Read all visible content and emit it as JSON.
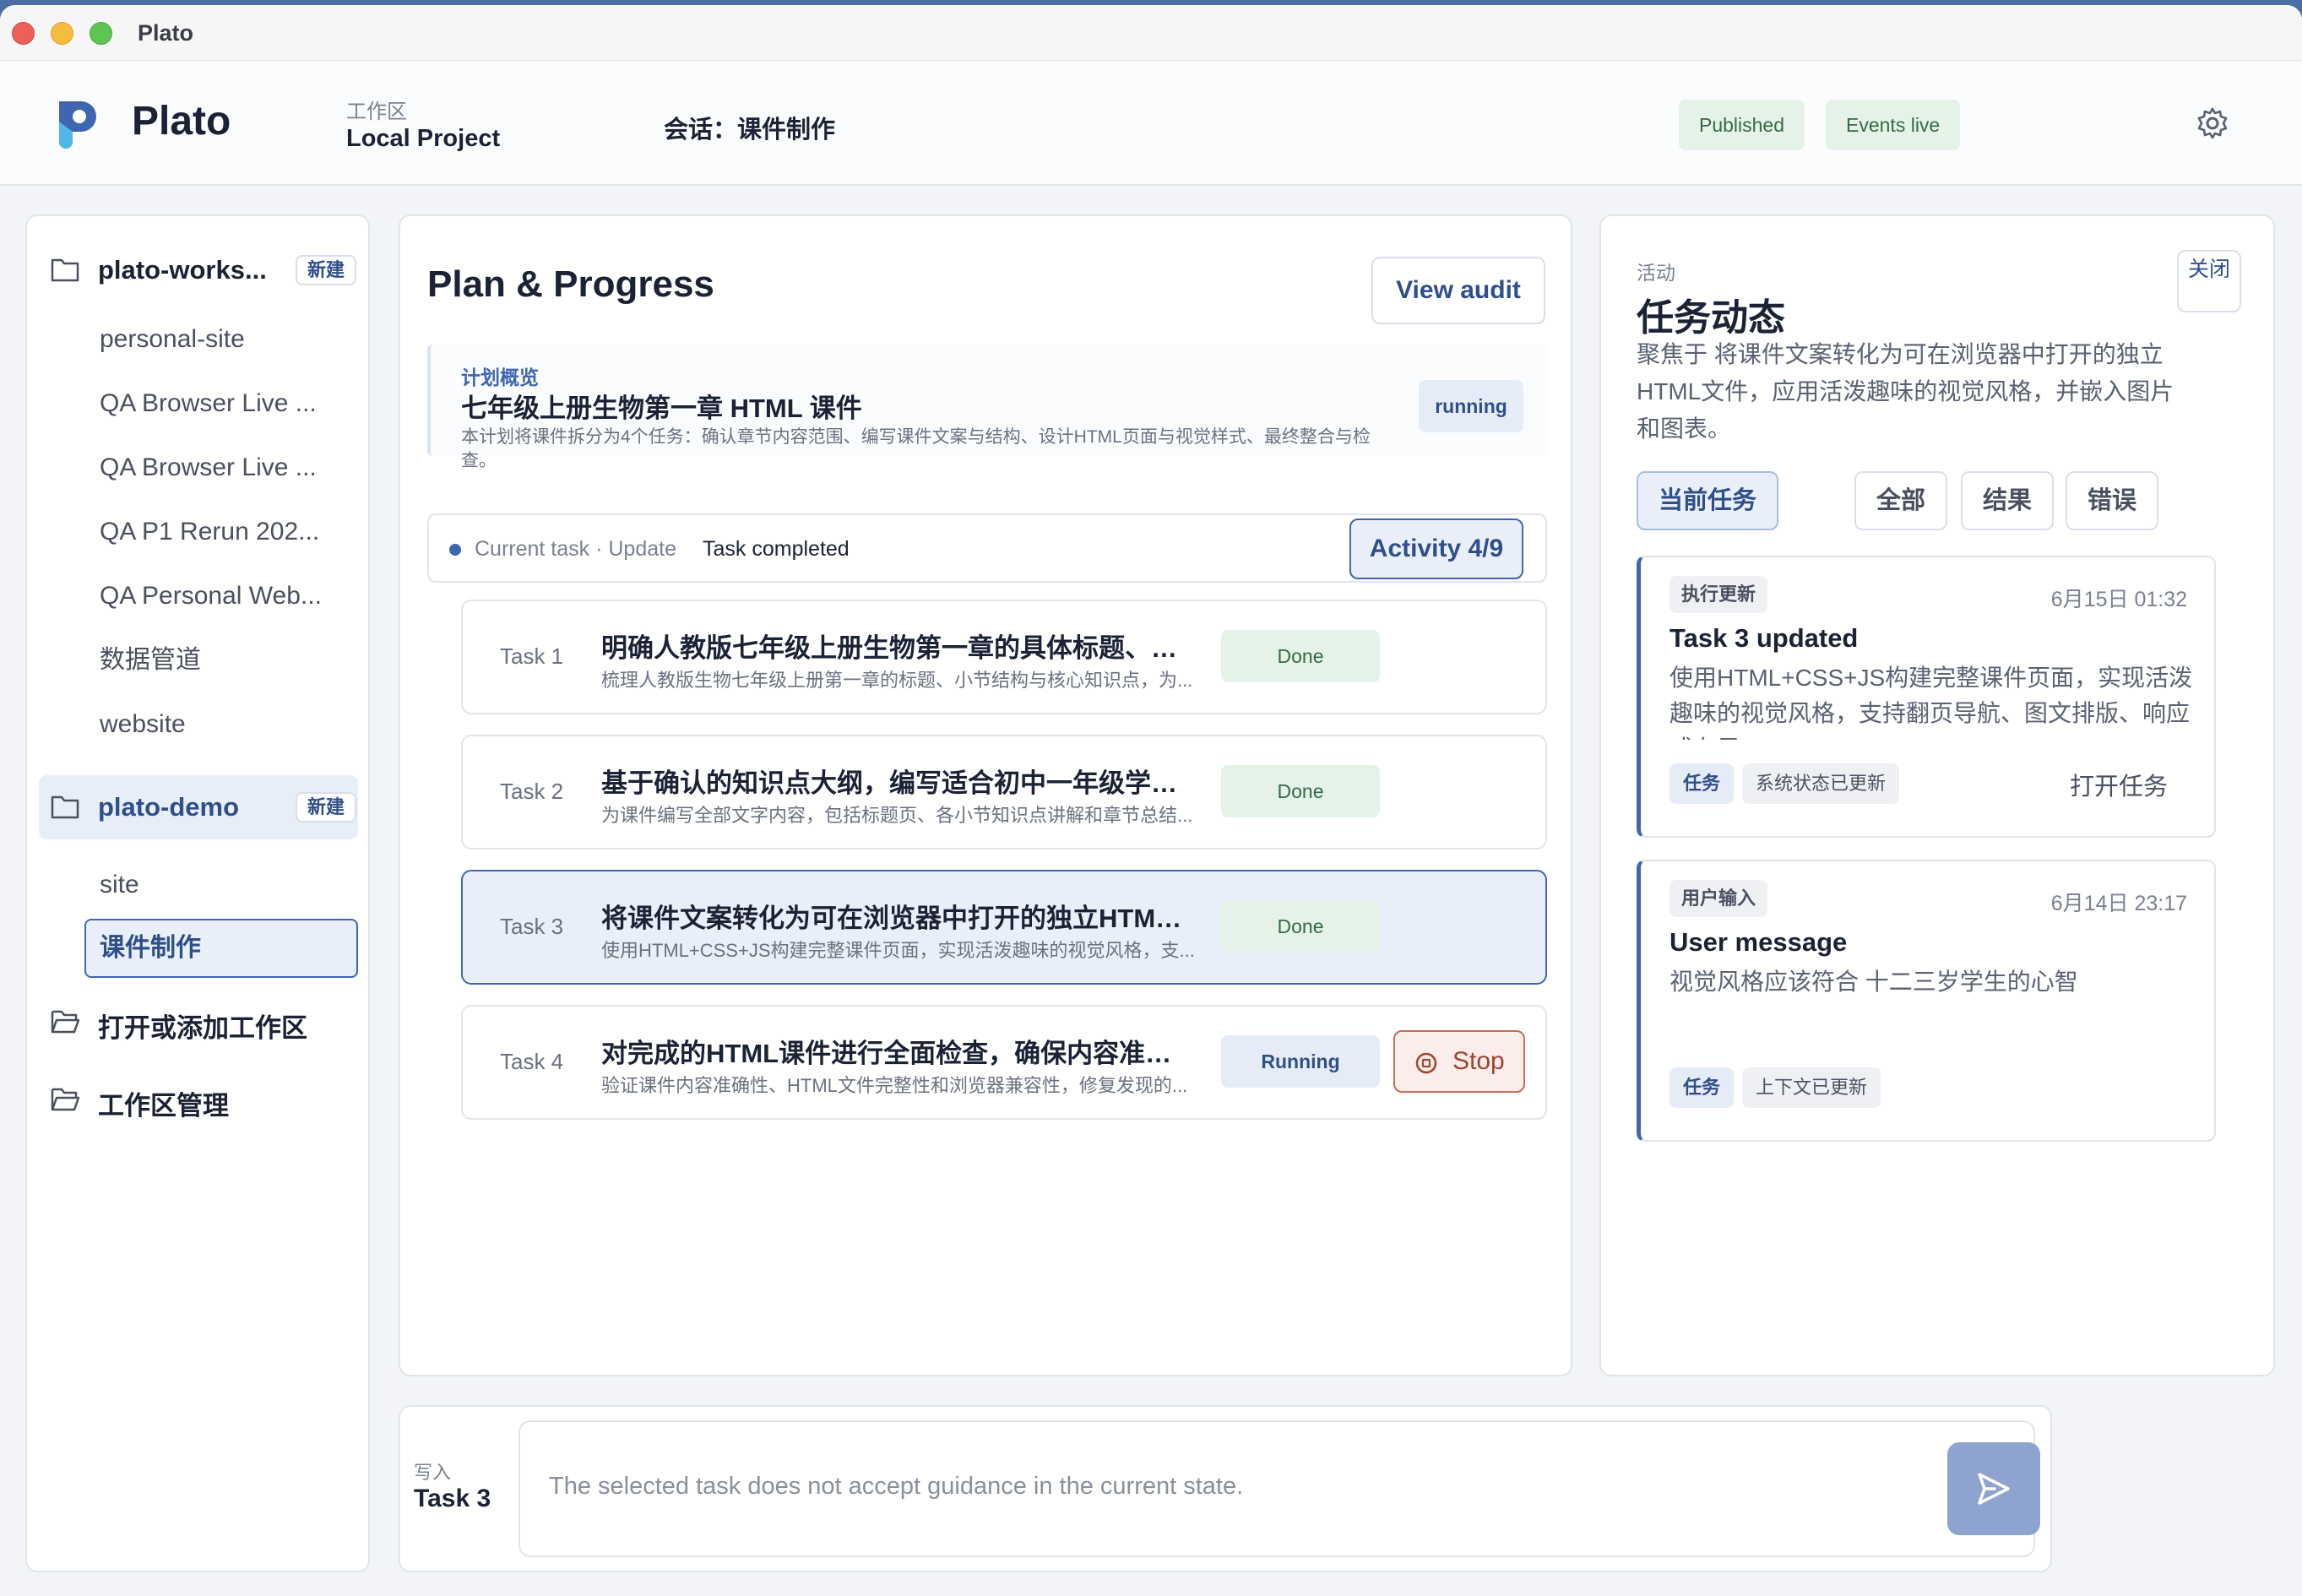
{
  "window": {
    "title": "Plato"
  },
  "header": {
    "brand": "Plato",
    "workspace_label": "工作区",
    "workspace_value": "Local Project",
    "session": "会话：课件制作",
    "badges": [
      "Published",
      "Events live"
    ],
    "settings_icon": "gear-icon"
  },
  "sidebar": {
    "workspaces": [
      {
        "name": "plato-works...",
        "new_label": "新建",
        "sessions": [
          "personal-site",
          "QA Browser Live ...",
          "QA Browser Live ...",
          "QA P1 Rerun 202...",
          "QA Personal Web...",
          "数据管道",
          "website"
        ]
      },
      {
        "name": "plato-demo",
        "new_label": "新建",
        "sessions": [
          "site",
          "课件制作"
        ],
        "active_session": "课件制作"
      }
    ],
    "actions": [
      "打开或添加工作区",
      "工作区管理"
    ]
  },
  "main": {
    "title": "Plan & Progress",
    "audit_button": "View audit",
    "overview": {
      "label": "计划概览",
      "title": "七年级上册生物第一章 HTML 课件",
      "desc": "本计划将课件拆分为4个任务：确认章节内容范围、编写课件文案与结构、设计HTML页面与视觉样式、最终整合与检查。",
      "status": "running"
    },
    "current": {
      "text": "Current task · Update",
      "strong": "Task completed",
      "activity_button": "Activity 4/9"
    },
    "tasks": [
      {
        "num": "Task 1",
        "title": "明确人教版七年级上册生物第一章的具体标题、小...",
        "desc": "梳理人教版生物七年级上册第一章的标题、小节结构与核心知识点，为...",
        "status": "Done"
      },
      {
        "num": "Task 2",
        "title": "基于确认的知识点大纲，编写适合初中一年级学生...",
        "desc": "为课件编写全部文字内容，包括标题页、各小节知识点讲解和章节总结...",
        "status": "Done"
      },
      {
        "num": "Task 3",
        "title": "将课件文案转化为可在浏览器中打开的独立HTML...",
        "desc": "使用HTML+CSS+JS构建完整课件页面，实现活泼趣味的视觉风格，支...",
        "status": "Done"
      },
      {
        "num": "Task 4",
        "title": "对完成的HTML课件进行全面检查，确保内容准确...",
        "desc": "验证课件内容准确性、HTML文件完整性和浏览器兼容性，修复发现的...",
        "status": "Running",
        "stop_label": "Stop"
      }
    ]
  },
  "activity": {
    "label": "活动",
    "title": "任务动态",
    "close_label": "关闭",
    "desc": "聚焦于 将课件文案转化为可在浏览器中打开的独立HTML文件，应用活泼趣味的视觉风格，并嵌入图片和图表。",
    "filters": [
      "当前任务",
      "全部",
      "结果",
      "错误"
    ],
    "events": [
      {
        "tag": "执行更新",
        "date": "6月15日 01:32",
        "title": "Task 3 updated",
        "body": "使用HTML+CSS+JS构建完整课件页面，实现活泼趣味的视觉风格，支持翻页导航、图文排版、响应式布局。",
        "chips": [
          "任务",
          "系统状态已更新"
        ],
        "open_label": "打开任务"
      },
      {
        "tag": "用户输入",
        "date": "6月14日 23:17",
        "title": "User message",
        "body": "视觉风格应该符合 十二三岁学生的心智",
        "chips": [
          "任务",
          "上下文已更新"
        ]
      }
    ]
  },
  "composer": {
    "label": "写入",
    "task": "Task 3",
    "placeholder": "The selected task does not accept guidance in the current state."
  },
  "colors": {
    "accent": "#3f66b0",
    "done_bg": "#e4f2e7",
    "stop": "#a4432e"
  }
}
